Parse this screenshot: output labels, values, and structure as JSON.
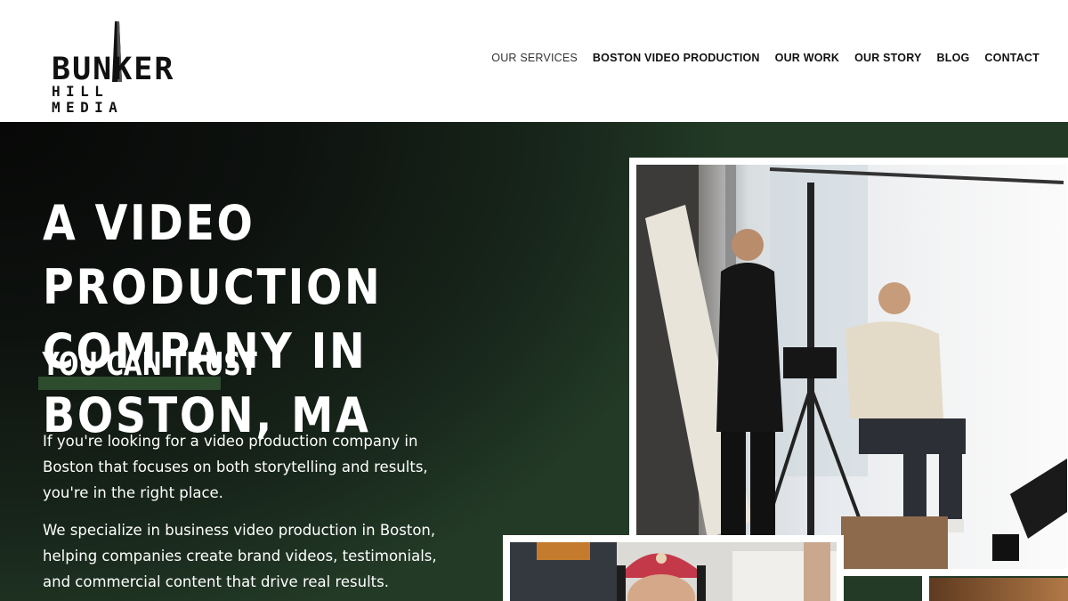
{
  "brand": {
    "line1": "BUNKER",
    "line2": "HILL MEDIA"
  },
  "nav": {
    "items": [
      {
        "label": "OUR SERVICES"
      },
      {
        "label": "BOSTON VIDEO PRODUCTION"
      },
      {
        "label": "OUR WORK"
      },
      {
        "label": "OUR STORY"
      },
      {
        "label": "BLOG"
      },
      {
        "label": "CONTACT"
      }
    ]
  },
  "hero": {
    "title_line1": "A VIDEO PRODUCTION",
    "title_line2": "COMPANY IN BOSTON, MA",
    "tagline": "YOU CAN TRUST",
    "paragraph1": "If you're looking for a video production company in Boston that focuses on both storytelling and results, you're in the right place.",
    "paragraph2": "We specialize in business video production in Boston, helping companies create brand videos, testimonials, and commercial content that drive real results."
  },
  "colors": {
    "accent_green": "#2d4c2e",
    "hero_bg_dark": "#0e120f",
    "hero_bg_green": "#233a26"
  },
  "icons": {
    "logo_mark": "obelisk-monument-icon"
  }
}
